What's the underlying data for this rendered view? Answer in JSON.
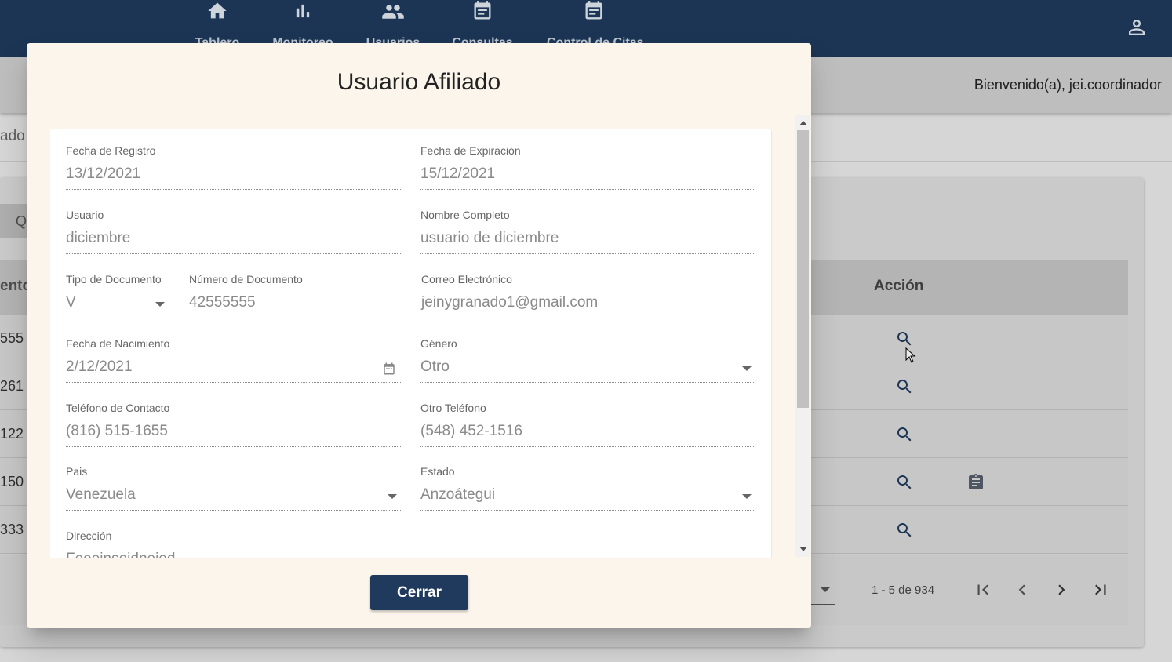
{
  "nav": {
    "items": [
      {
        "label": "Tablero",
        "icon": "home-icon"
      },
      {
        "label": "Monitoreo",
        "icon": "bar-chart-icon"
      },
      {
        "label": "Usuarios",
        "icon": "people-icon"
      },
      {
        "label": "Consultas",
        "icon": "event-note-icon"
      },
      {
        "label": "Control de Citas",
        "icon": "event-note-icon"
      }
    ],
    "profile_icon": "person-icon"
  },
  "header": {
    "welcome": "Bienvenido(a), jei.coordinador"
  },
  "background": {
    "section_title": "ado",
    "search_glyph": "Q",
    "table": {
      "partial_header": "ento",
      "action_header": "Acción",
      "rows": [
        "555",
        "261",
        "122",
        "150",
        "333"
      ]
    },
    "paginator": {
      "range": "1 - 5 de 934"
    }
  },
  "dialog": {
    "title": "Usuario Afiliado",
    "fields": {
      "fecha_registro": {
        "label": "Fecha de Registro",
        "value": "13/12/2021"
      },
      "fecha_expiracion": {
        "label": "Fecha de Expiración",
        "value": "15/12/2021"
      },
      "usuario": {
        "label": "Usuario",
        "value": "diciembre"
      },
      "nombre_completo": {
        "label": "Nombre Completo",
        "value": "usuario de diciembre"
      },
      "tipo_documento": {
        "label": "Tipo de Documento",
        "value": "V"
      },
      "numero_documento": {
        "label": "Número de Documento",
        "value": "42555555"
      },
      "correo": {
        "label": "Correo Electrónico",
        "value": "jeinygranado1@gmail.com"
      },
      "fecha_nacimiento": {
        "label": "Fecha de Nacimiento",
        "value": "2/12/2021"
      },
      "genero": {
        "label": "Género",
        "value": "Otro"
      },
      "telefono": {
        "label": "Teléfono de Contacto",
        "value": "(816) 515-1655"
      },
      "otro_telefono": {
        "label": "Otro Teléfono",
        "value": "(548) 452-1516"
      },
      "pais": {
        "label": "Pais",
        "value": "Venezuela"
      },
      "estado": {
        "label": "Estado",
        "value": "Anzoátegui"
      },
      "direccion": {
        "label": "Dirección",
        "value": "Feeeinseidneied"
      }
    },
    "close_label": "Cerrar"
  },
  "colors": {
    "nav_bg": "#1f3a5c",
    "dialog_bg": "#fcf5eb",
    "accent": "#1f3a5c"
  }
}
